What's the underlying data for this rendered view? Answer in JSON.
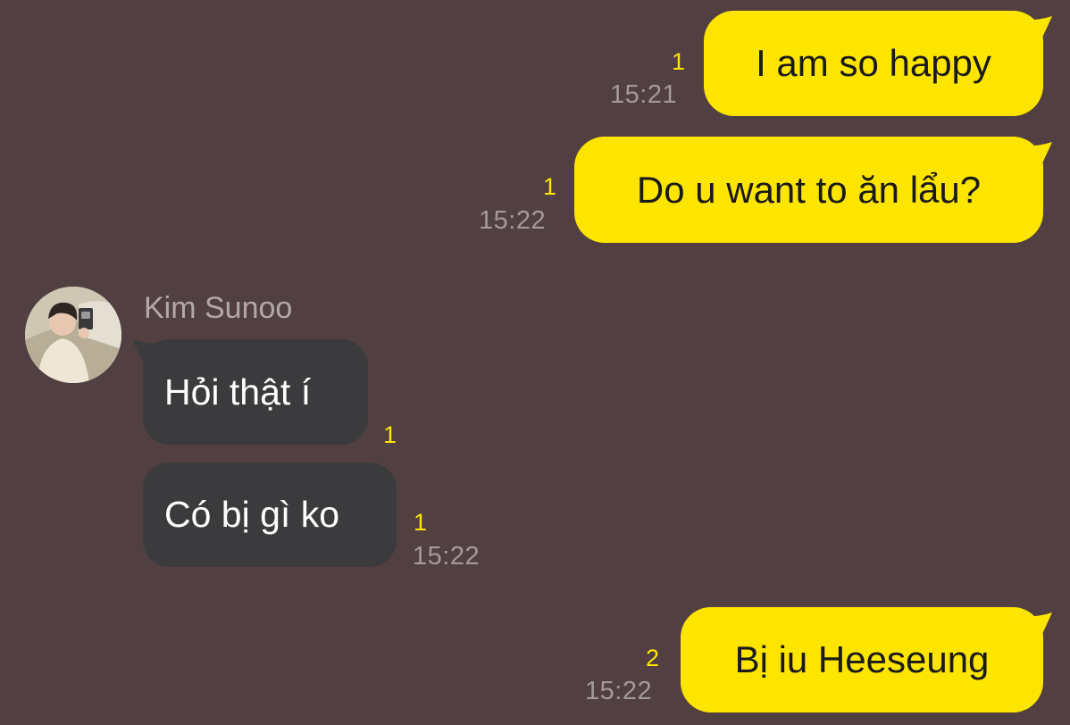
{
  "conversation": {
    "contact_name": "Kim Sunoo",
    "messages": [
      {
        "direction": "outgoing",
        "text": "I am so happy",
        "unread": "1",
        "time": "15:21"
      },
      {
        "direction": "outgoing",
        "text": "Do u want to ăn lẩu?",
        "unread": "1",
        "time": "15:22"
      },
      {
        "direction": "incoming",
        "text": "Hỏi thật í",
        "unread": "1"
      },
      {
        "direction": "incoming",
        "text": "Có bị gì ko",
        "unread": "1",
        "time": "15:22"
      },
      {
        "direction": "outgoing",
        "text": "Bị iu Heeseung",
        "unread": "2",
        "time": "15:22"
      }
    ]
  },
  "colors": {
    "background": "#523f41",
    "outgoing_bubble": "#fee500",
    "incoming_bubble": "#3b3b3d",
    "unread_count": "#fee500",
    "timestamp": "#a49a9b"
  },
  "icons": {
    "avatar": "profile-photo"
  }
}
